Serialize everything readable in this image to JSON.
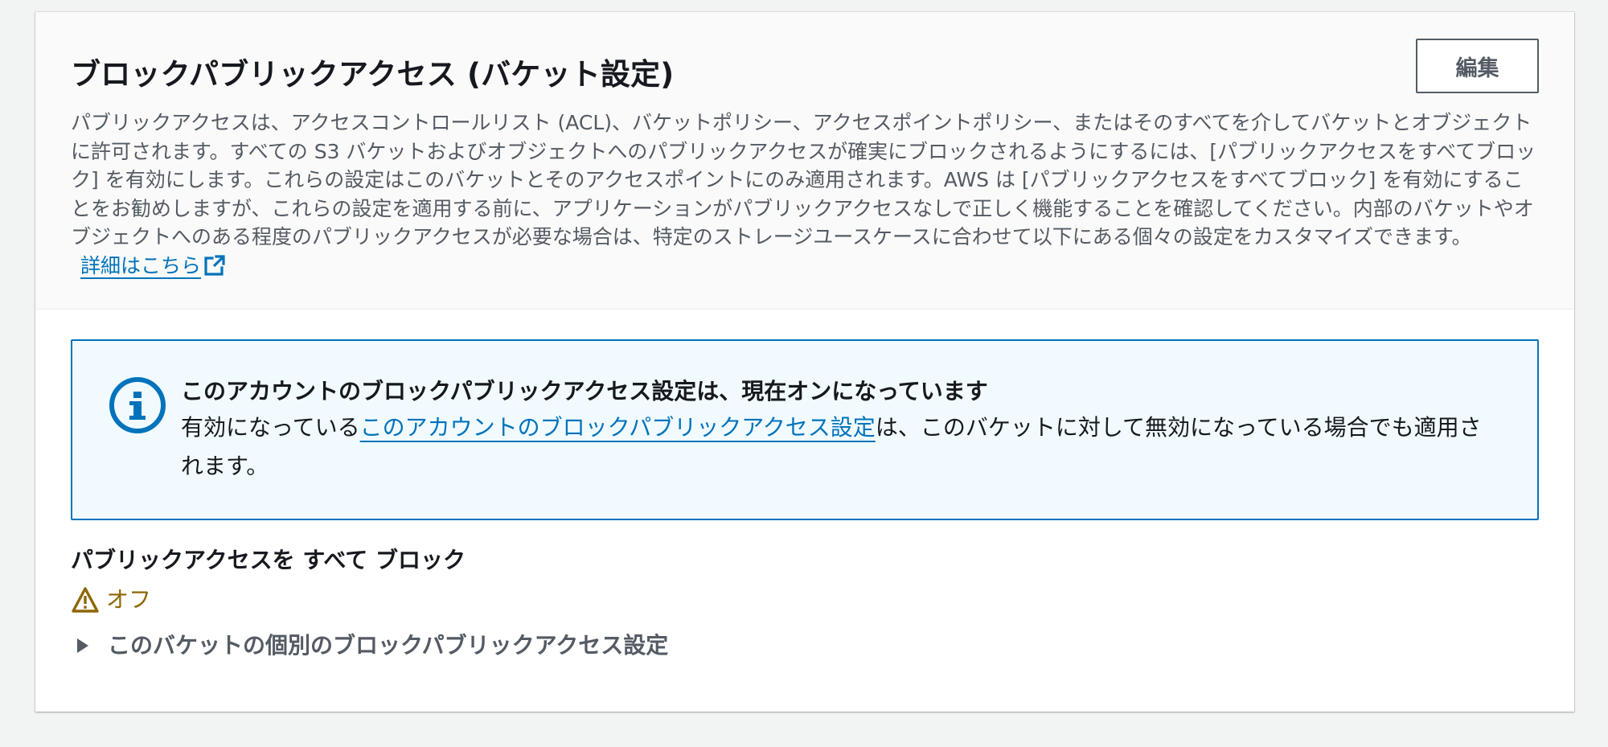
{
  "panel": {
    "title": "ブロックパブリックアクセス (バケット設定)",
    "edit_label": "編集",
    "description": "パブリックアクセスは、アクセスコントロールリスト (ACL)、バケットポリシー、アクセスポイントポリシー、またはそのすべてを介してバケットとオブジェクトに許可されます。すべての S3 バケットおよびオブジェクトへのパブリックアクセスが確実にブロックされるようにするには、[パブリックアクセスをすべてブロック] を有効にします。これらの設定はこのバケットとそのアクセスポイントにのみ適用されます。AWS は [パブリックアクセスをすべてブロック] を有効にすることをお勧めしますが、これらの設定を適用する前に、アプリケーションがパブリックアクセスなしで正しく機能することを確認してください。内部のバケットやオブジェクトへのある程度のパブリックアクセスが必要な場合は、特定のストレージユースケースに合わせて以下にある個々の設定をカスタマイズできます。",
    "learn_more": "詳細はこちら",
    "learn_more_icon": "external-link-icon"
  },
  "info": {
    "icon": "info-icon",
    "heading": "このアカウントのブロックパブリックアクセス設定は、現在オンになっています",
    "body_prefix": "有効になっている",
    "body_link": "このアカウントのブロックパブリックアクセス設定",
    "body_suffix": "は、このバケットに対して無効になっている場合でも適用されます。"
  },
  "setting": {
    "label": "パブリックアクセスを すべて ブロック",
    "status": "オフ",
    "status_icon": "warning-icon",
    "status_color": "#8d6605"
  },
  "expander": {
    "label": "このバケットの個別のブロックパブリックアクセス設定",
    "icon": "caret-right-icon"
  },
  "colors": {
    "link": "#0073bb",
    "info_border": "#0073bb",
    "info_background": "#f1faff"
  }
}
